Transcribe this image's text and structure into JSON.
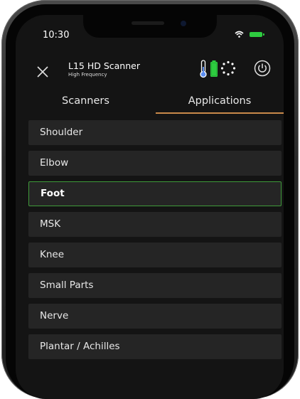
{
  "status_bar": {
    "time": "10:30",
    "wifi_icon": "wifi-icon",
    "battery_icon": "battery-icon"
  },
  "header": {
    "close_icon": "close-icon",
    "scanner_name": "L15 HD Scanner",
    "scanner_subtitle": "High Frequency",
    "icons": [
      "thermometer-icon",
      "battery-charge-icon",
      "loading-spinner-icon",
      "power-icon"
    ]
  },
  "tabs": [
    {
      "label": "Scanners",
      "active": false
    },
    {
      "label": "Applications",
      "active": true
    }
  ],
  "applications": [
    {
      "label": "Shoulder",
      "selected": false
    },
    {
      "label": "Elbow",
      "selected": false
    },
    {
      "label": "Foot",
      "selected": true
    },
    {
      "label": "MSK",
      "selected": false
    },
    {
      "label": "Knee",
      "selected": false
    },
    {
      "label": "Small Parts",
      "selected": false
    },
    {
      "label": "Nerve",
      "selected": false
    },
    {
      "label": "Plantar / Achilles",
      "selected": false
    }
  ],
  "colors": {
    "background": "#141414",
    "list_item": "#252525",
    "selected_border": "#3f9a3a",
    "tab_underline": "#c9894a",
    "battery_green": "#2ecc40",
    "thermometer_blue": "#5b8def"
  }
}
